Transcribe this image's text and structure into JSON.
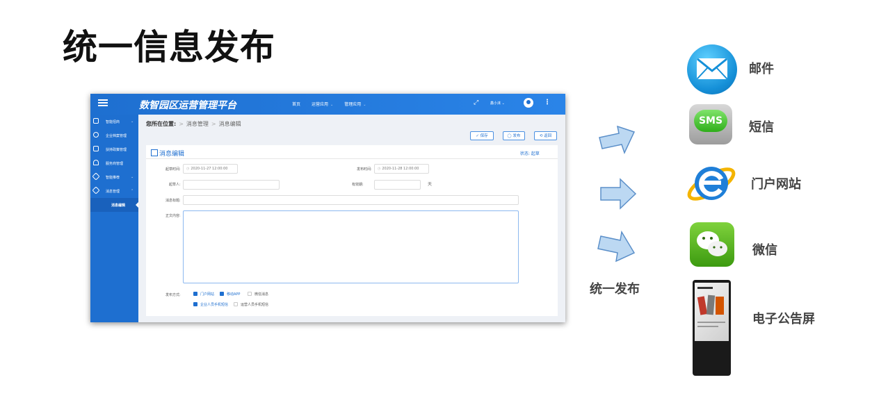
{
  "slide_title": "统一信息发布",
  "app": {
    "title": "数智园区运营管理平台",
    "nav": [
      {
        "label": "首页"
      },
      {
        "label": "运营应用"
      },
      {
        "label": "管理应用"
      }
    ],
    "user_name": "鑫小沫",
    "sidebar": [
      {
        "label": "智能招商"
      },
      {
        "label": "企业档案管理"
      },
      {
        "label": "扶持政策管理"
      },
      {
        "label": "服务商管理"
      },
      {
        "label": "智能推荐"
      },
      {
        "label": "消息管理"
      },
      {
        "label": "消息编辑"
      }
    ],
    "breadcrumb": {
      "prefix": "您所在位置:",
      "items": [
        "消息管理",
        "消息编辑"
      ]
    },
    "buttons": {
      "save": "✓ 保存",
      "publish": "◯ 发布",
      "back": "⟲ 返回"
    },
    "card": {
      "title": "消息编辑",
      "status": "状态: 起草",
      "fields": {
        "draft_time_label": "起草时间:",
        "draft_time_value": "2020-11-27 12:00:00",
        "publish_time_label": "发布时间:",
        "publish_time_value": "2020-11-28 12:00:00",
        "drafter_label": "起草人:",
        "validity_label": "有效期:",
        "validity_unit": "天",
        "subject_label": "消息标题:",
        "body_label": "正文内容:",
        "publish_method_label": "发布方式:"
      },
      "publish_options": [
        {
          "label": "门户网站",
          "checked": true
        },
        {
          "label": "移动APP",
          "checked": true
        },
        {
          "label": "微信消息",
          "checked": false
        }
      ],
      "sms_options": [
        {
          "label": "企业人员手机短信",
          "checked": true
        },
        {
          "label": "运营人员手机短信",
          "checked": false
        }
      ]
    }
  },
  "arrow_caption": "统一发布",
  "channels": [
    {
      "label": "邮件",
      "icon": "mail-icon"
    },
    {
      "label": "短信",
      "icon": "sms-icon",
      "badge": "SMS"
    },
    {
      "label": "门户网站",
      "icon": "ie-browser-icon"
    },
    {
      "label": "微信",
      "icon": "wechat-icon"
    },
    {
      "label": "电子公告屏",
      "icon": "kiosk-screen-icon"
    }
  ],
  "colors": {
    "primary": "#1e6fd0",
    "arrow_fill": "#bcd8f2",
    "arrow_stroke": "#5b8fc9"
  }
}
